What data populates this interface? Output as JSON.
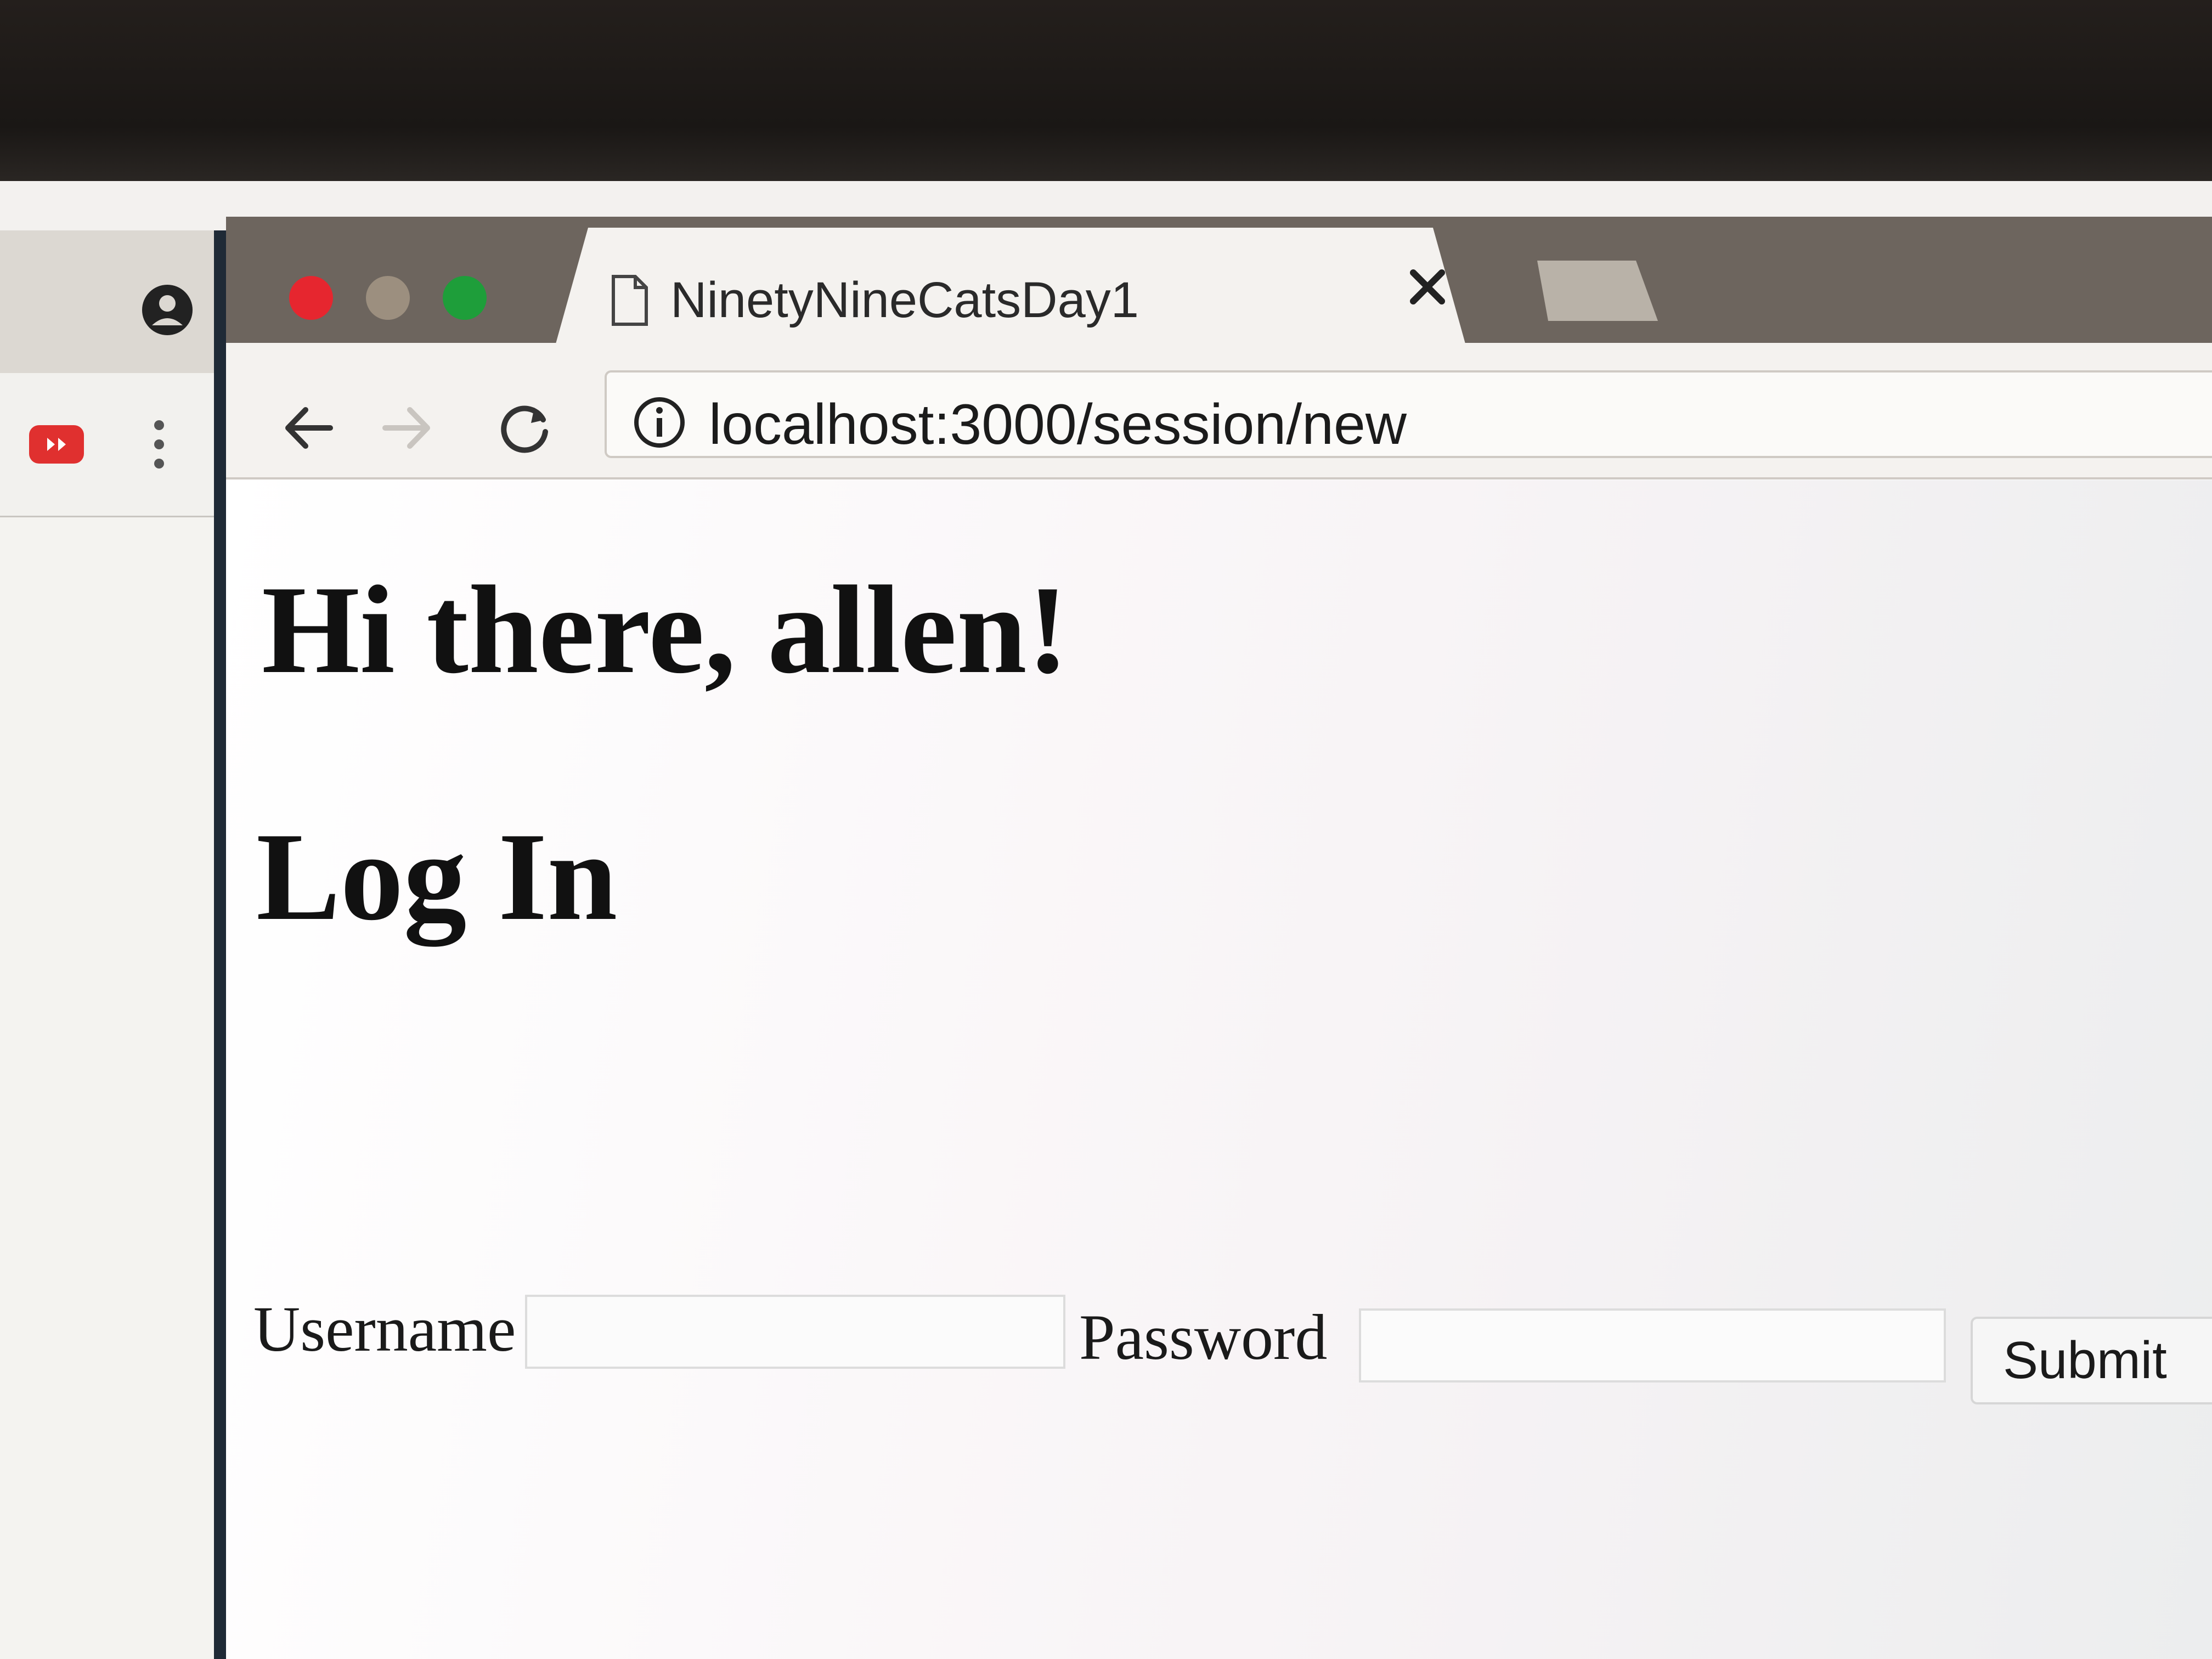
{
  "browser": {
    "tab_title": "NinetyNineCatsDay1",
    "url": "localhost:3000/session/new"
  },
  "page": {
    "greeting": "Hi there, allen!",
    "login_heading": "Log In",
    "form": {
      "username_label": "Username",
      "username_value": "",
      "password_label": "Password",
      "password_value": "",
      "submit_label": "Submit"
    }
  },
  "colors": {
    "close_button": "#e6262f",
    "minimize_button": "#9c8f7f",
    "zoom_button": "#1e9e3a",
    "extension_icon": "#e0302f"
  },
  "icons": {
    "left_window": [
      "profile-icon",
      "extension-icon",
      "kebab-menu-icon"
    ],
    "tab": [
      "page-icon",
      "close-icon"
    ],
    "toolbar": [
      "back-arrow-icon",
      "forward-arrow-icon",
      "reload-icon",
      "info-icon"
    ]
  }
}
